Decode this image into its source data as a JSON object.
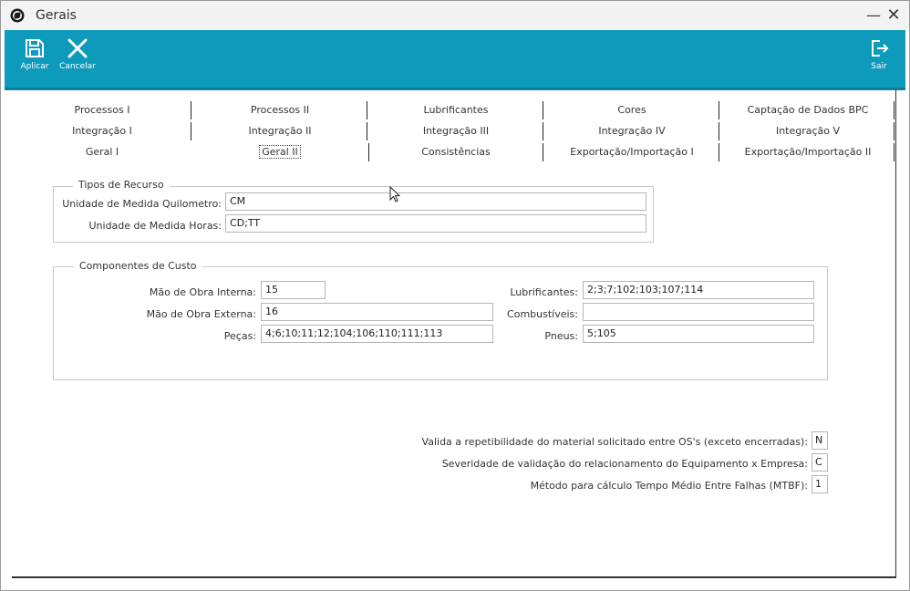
{
  "window": {
    "title": "Gerais"
  },
  "toolbar": {
    "apply_label": "Aplicar",
    "cancel_label": "Cancelar",
    "exit_label": "Sair"
  },
  "tabs": {
    "row1": [
      "Processos I",
      "Processos II",
      "Lubrificantes",
      "Cores",
      "Captação de Dados BPC"
    ],
    "row2": [
      "Integração I",
      "Integração II",
      "Integração III",
      "Integração IV",
      "Integração V"
    ],
    "row3": [
      "Geral I",
      "Geral II",
      "Consistências",
      "Exportação/Importação I",
      "Exportação/Importação II"
    ],
    "active": "Geral II"
  },
  "tipos_recurso": {
    "legend": "Tipos de Recurso",
    "quilometro_label": "Unidade de Medida Quilometro:",
    "quilometro_value": "CM",
    "horas_label": "Unidade de Medida Horas:",
    "horas_value": "CD;TT"
  },
  "componentes_custo": {
    "legend": "Componentes de Custo",
    "mao_interna_label": "Mão de Obra Interna:",
    "mao_interna_value": "15",
    "mao_externa_label": "Mão de Obra Externa:",
    "mao_externa_value": "16",
    "pecas_label": "Peças:",
    "pecas_value": "4;6;10;11;12;104;106;110;111;113",
    "lubrificantes_label": "Lubrificantes:",
    "lubrificantes_value": "2;3;7;102;103;107;114",
    "combustiveis_label": "Combustíveis:",
    "combustiveis_value": "",
    "pneus_label": "Pneus:",
    "pneus_value": "5;105"
  },
  "options": {
    "repetibilidade_label": "Valida a repetibilidade do material solicitado entre OS's (exceto encerradas):",
    "repetibilidade_value": "N",
    "severidade_label": "Severidade de validação do relacionamento do Equipamento x Empresa:",
    "severidade_value": "C",
    "mtbf_label": "Método para cálculo Tempo Médio Entre Falhas (MTBF):",
    "mtbf_value": "1"
  },
  "colors": {
    "toolbar": "#0e9bbb",
    "titlebar": "#f3f3f3"
  }
}
